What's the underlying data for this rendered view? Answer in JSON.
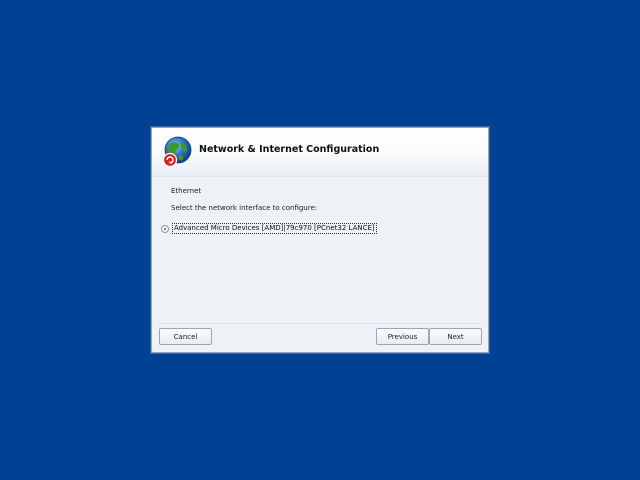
{
  "dialog": {
    "title": "Network & Internet Configuration",
    "logo_icon": "network-globe-icon",
    "section_label": "Ethernet",
    "instruction": "Select the network interface to configure:",
    "interfaces": [
      {
        "label": "Advanced Micro Devices [AMD]|79c970 [PCnet32 LANCE]",
        "selected": true
      }
    ],
    "buttons": {
      "cancel": "Cancel",
      "previous": "Previous",
      "next": "Next"
    }
  },
  "colors": {
    "desktop_background": "#004193",
    "dialog_background": "#eef1f5",
    "globe_green": "#3a9a2a",
    "globe_blue": "#2d5fa8",
    "badge_red": "#d62020"
  }
}
